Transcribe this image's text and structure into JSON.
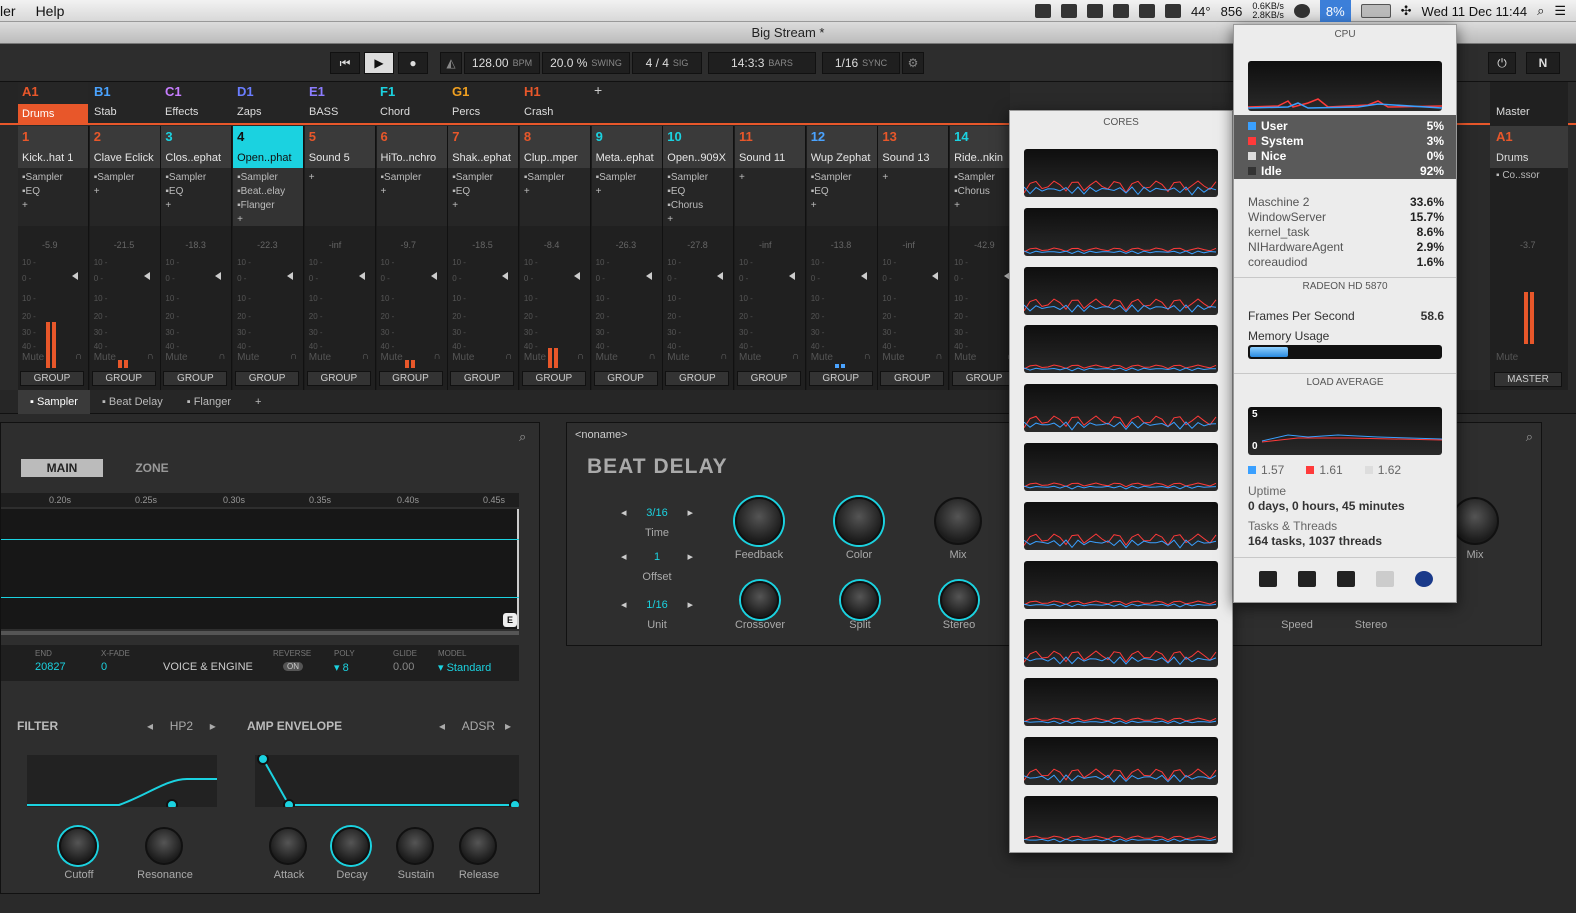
{
  "menubar": {
    "app_partial": "ler",
    "help": "Help",
    "temp": "44°",
    "fan": "856",
    "net_up": "0.6KB/s",
    "net_down": "2.8KB/s",
    "cpu_percent": "8%",
    "clock": "Wed 11 Dec  11:44"
  },
  "window": {
    "title": "Big Stream *"
  },
  "transport": {
    "bpm": "128.00",
    "bpm_unit": "BPM",
    "swing": "20.0 %",
    "swing_unit": "SWING",
    "sig": "4 / 4",
    "sig_unit": "SIG",
    "position": "14:3:3",
    "position_unit": "BARS",
    "sync": "1/16",
    "sync_unit": "SYNC"
  },
  "groups": [
    {
      "id": "A1",
      "name": "Drums",
      "color": "#e8572a",
      "selected": true
    },
    {
      "id": "B1",
      "name": "Stab",
      "color": "#4aa3ff"
    },
    {
      "id": "C1",
      "name": "Effects",
      "color": "#c77dff"
    },
    {
      "id": "D1",
      "name": "Zaps",
      "color": "#6a7dff"
    },
    {
      "id": "E1",
      "name": "BASS",
      "color": "#8c7dff"
    },
    {
      "id": "F1",
      "name": "Chord",
      "color": "#1bd2e0"
    },
    {
      "id": "G1",
      "name": "Percs",
      "color": "#f0a020"
    },
    {
      "id": "H1",
      "name": "Crash",
      "color": "#e8572a"
    }
  ],
  "group_add": "+",
  "channels": [
    {
      "num": "1",
      "name": "Kick..hat 1",
      "plugins": [
        "Sampler",
        "EQ",
        "+"
      ],
      "db": "-5.9",
      "color": "#e8572a",
      "meter": 46
    },
    {
      "num": "2",
      "name": "Clave Eclick",
      "plugins": [
        "Sampler",
        "+"
      ],
      "db": "-21.5",
      "color": "#e8572a",
      "meter": 8
    },
    {
      "num": "3",
      "name": "Clos..ephat",
      "plugins": [
        "Sampler",
        "EQ",
        "+"
      ],
      "db": "-18.3",
      "color": "#1bd2e0",
      "meter": 0
    },
    {
      "num": "4",
      "name": "Open..phat",
      "plugins": [
        "Sampler",
        "Beat..elay",
        "Flanger",
        "+"
      ],
      "db": "-22.3",
      "color": "#111",
      "meter": 0,
      "selected": true
    },
    {
      "num": "5",
      "name": "Sound 5",
      "plugins": [
        "+"
      ],
      "db": "-inf",
      "color": "#e8572a",
      "meter": 0
    },
    {
      "num": "6",
      "name": "HiTo..nchro",
      "plugins": [
        "Sampler",
        "+"
      ],
      "db": "-9.7",
      "color": "#e8572a",
      "meter": 8
    },
    {
      "num": "7",
      "name": "Shak..ephat",
      "plugins": [
        "Sampler",
        "EQ",
        "+"
      ],
      "db": "-18.5",
      "color": "#e8572a",
      "meter": 0
    },
    {
      "num": "8",
      "name": "Clup..mper",
      "plugins": [
        "Sampler",
        "+"
      ],
      "db": "-8.4",
      "color": "#e8572a",
      "meter": 20
    },
    {
      "num": "9",
      "name": "Meta..ephat",
      "plugins": [
        "Sampler",
        "+"
      ],
      "db": "-26.3",
      "color": "#1bd2e0",
      "meter": 0
    },
    {
      "num": "10",
      "name": "Open..909X",
      "plugins": [
        "Sampler",
        "EQ",
        "Chorus",
        "+"
      ],
      "db": "-27.8",
      "color": "#1bd2e0",
      "meter": 0
    },
    {
      "num": "11",
      "name": "Sound 11",
      "plugins": [
        "+"
      ],
      "db": "-inf",
      "color": "#e8572a",
      "meter": 0
    },
    {
      "num": "12",
      "name": "Wup Zephat",
      "plugins": [
        "Sampler",
        "EQ",
        "+"
      ],
      "db": "-13.8",
      "color": "#4aa3ff",
      "meter": 4
    },
    {
      "num": "13",
      "name": "Sound 13",
      "plugins": [
        "+"
      ],
      "db": "-inf",
      "color": "#e8572a",
      "meter": 0
    },
    {
      "num": "14",
      "name": "Ride..nkin",
      "plugins": [
        "Sampler",
        "Chorus",
        "+"
      ],
      "db": "-42.9",
      "color": "#1bd2e0",
      "meter": 0
    }
  ],
  "mixer_labels": {
    "mute": "Mute",
    "group": "GROUP",
    "scale": [
      "10 -",
      "0 -",
      "10 -",
      "20 -",
      "30 -",
      "40 -"
    ]
  },
  "master": {
    "label": "Master",
    "id": "A1",
    "name": "Drums",
    "plugin": "Co..ssor",
    "db": "-3.7",
    "button": "MASTER"
  },
  "plugin_tabs": [
    "Sampler",
    "Beat Delay",
    "Flanger",
    "+"
  ],
  "sampler": {
    "tab_main": "MAIN",
    "tab_zone": "ZONE",
    "ruler": [
      "0.20s",
      "0.25s",
      "0.30s",
      "0.35s",
      "0.40s",
      "0.45s"
    ],
    "end_label": "END",
    "end_value": "20827",
    "xfade_label": "X-FADE",
    "xfade_value": "0",
    "voice_engine": "VOICE & ENGINE",
    "reverse_label": "REVERSE",
    "reverse_value": "ON",
    "poly_label": "POLY",
    "poly_value": "▾ 8",
    "glide_label": "GLIDE",
    "glide_value": "0.00",
    "model_label": "MODEL",
    "model_value": "▾ Standard",
    "filter_title": "FILTER",
    "filter_mode": "HP2",
    "env_title": "AMP ENVELOPE",
    "env_mode": "ADSR",
    "knobs": [
      "Cutoff",
      "Resonance",
      "Attack",
      "Decay",
      "Sustain",
      "Release"
    ],
    "e_marker": "E"
  },
  "delay": {
    "noname": "<noname>",
    "title": "BEAT DELAY",
    "time_value": "3/16",
    "time_label": "Time",
    "offset_value": "1",
    "offset_label": "Offset",
    "unit_value": "1/16",
    "unit_label": "Unit",
    "knobs_top": [
      "Feedback",
      "Color",
      "Mix"
    ],
    "knobs_bottom": [
      "Crossover",
      "Split",
      "Stereo"
    ]
  },
  "flanger_visible": {
    "mix": "Mix",
    "speed": "Speed",
    "stereo": "Stereo"
  },
  "cores": {
    "header": "CORES",
    "count": 12
  },
  "cpu": {
    "header": "CPU",
    "user_label": "User",
    "user_value": "5%",
    "user_color": "#3aa0ff",
    "system_label": "System",
    "system_value": "3%",
    "system_color": "#ff3a3a",
    "nice_label": "Nice",
    "nice_value": "0%",
    "idle_label": "Idle",
    "idle_value": "92%",
    "processes": [
      {
        "name": "Maschine 2",
        "value": "33.6%"
      },
      {
        "name": "WindowServer",
        "value": "15.7%"
      },
      {
        "name": "kernel_task",
        "value": "8.6%"
      },
      {
        "name": "NIHardwareAgent",
        "value": "2.9%"
      },
      {
        "name": "coreaudiod",
        "value": "1.6%"
      }
    ],
    "gpu_header": "RADEON HD 5870",
    "fps_label": "Frames Per Second",
    "fps_value": "58.6",
    "mem_label": "Memory Usage",
    "mem_fraction": 0.2,
    "load_header": "LOAD AVERAGE",
    "load_max": "5",
    "load_min": "0",
    "load_1": "1.57",
    "load_5": "1.61",
    "load_15": "1.62",
    "uptime_label": "Uptime",
    "uptime_value": "0 days, 0 hours, 45 minutes",
    "tasks_label": "Tasks & Threads",
    "tasks_value": "164 tasks, 1037 threads"
  }
}
